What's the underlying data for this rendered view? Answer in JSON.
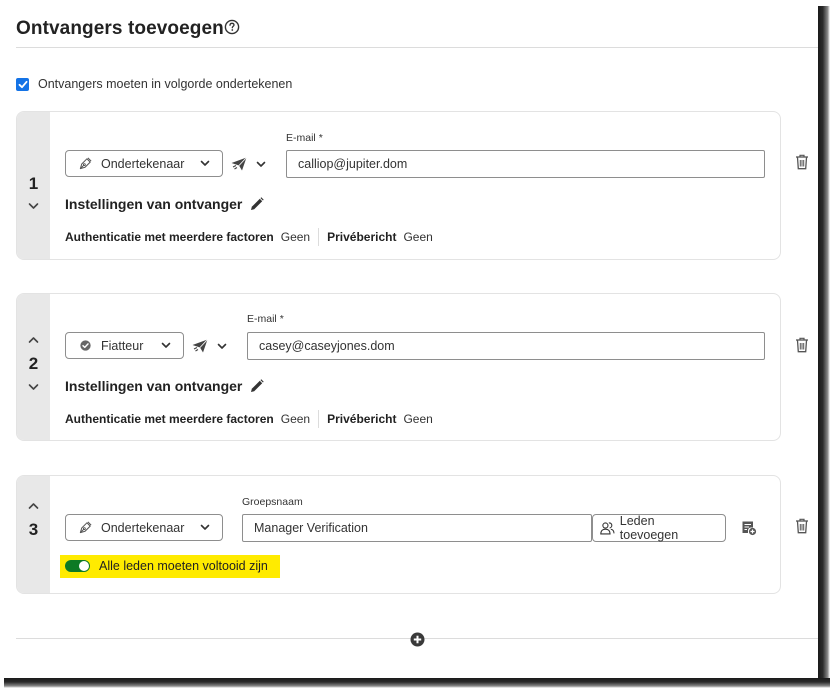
{
  "header": {
    "title": "Ontvangers toevoegen",
    "help_icon": "help-circle-icon"
  },
  "order": {
    "checked": true,
    "label": "Ontvangers moeten in volgorde ondertekenen"
  },
  "recipients": [
    {
      "index": "1",
      "can_move_up": false,
      "can_move_down": true,
      "role": {
        "label": "Ondertekenaar",
        "icon": "pen-nib-icon"
      },
      "delivery_icon": "paper-plane-icon",
      "email_label": "E-mail",
      "required_mark": "*",
      "email_value": "calliop@jupiter.dom",
      "settings_title": "Instellingen van ontvanger",
      "settings": [
        {
          "key": "Authenticatie met meerdere factoren",
          "value": "Geen"
        },
        {
          "key": "Privébericht",
          "value": "Geen"
        }
      ]
    },
    {
      "index": "2",
      "can_move_up": true,
      "can_move_down": true,
      "role": {
        "label": "Fiatteur",
        "icon": "check-circle-icon"
      },
      "delivery_icon": "paper-plane-icon",
      "email_label": "E-mail",
      "required_mark": "*",
      "email_value": "casey@caseyjones.dom",
      "settings_title": "Instellingen van ontvanger",
      "settings": [
        {
          "key": "Authenticatie met meerdere factoren",
          "value": "Geen"
        },
        {
          "key": "Privébericht",
          "value": "Geen"
        }
      ]
    },
    {
      "index": "3",
      "can_move_up": true,
      "can_move_down": false,
      "role": {
        "label": "Ondertekenaar",
        "icon": "pen-nib-icon"
      },
      "group_label": "Groepsnaam",
      "group_value": "Manager Verification",
      "add_members_label": "Leden toevoegen",
      "toggle": {
        "on": true,
        "label": "Alle leden moeten voltooid zijn"
      }
    }
  ],
  "footer": {
    "add_recipient_icon": "plus-circle-icon"
  },
  "colors": {
    "accent": "#1473e6",
    "toggle_on": "#0d7a24",
    "highlight": "#ffeb00",
    "rail": "#e8e8e8"
  }
}
